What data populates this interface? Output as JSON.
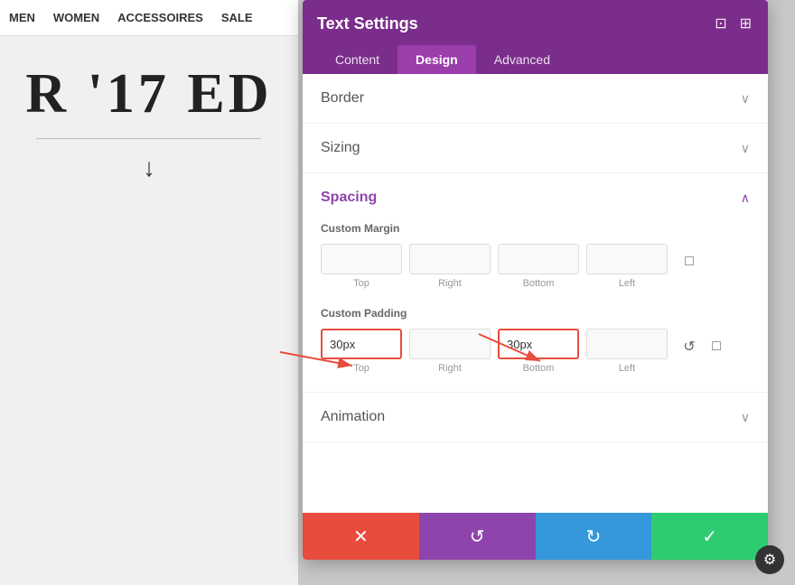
{
  "website": {
    "nav_items": [
      "MEN",
      "WOMEN",
      "ACCESSOIRES",
      "SALE"
    ],
    "hero_text": "R '17 ED",
    "arrow": "↓"
  },
  "panel": {
    "title": "Text Settings",
    "tabs": [
      {
        "label": "Content",
        "active": false
      },
      {
        "label": "Design",
        "active": true
      },
      {
        "label": "Advanced",
        "active": false
      }
    ],
    "sections": [
      {
        "label": "Border",
        "collapsed": true
      },
      {
        "label": "Sizing",
        "collapsed": true
      },
      {
        "label": "Spacing",
        "collapsed": false
      },
      {
        "label": "Animation",
        "collapsed": true
      }
    ],
    "spacing": {
      "custom_margin_label": "Custom Margin",
      "custom_padding_label": "Custom Padding",
      "margin_fields": [
        {
          "value": "",
          "label": "Top"
        },
        {
          "value": "",
          "label": "Right"
        },
        {
          "value": "",
          "label": "Bottom"
        },
        {
          "value": "",
          "label": "Left"
        }
      ],
      "padding_fields": [
        {
          "value": "30px",
          "label": "Top",
          "highlighted": true
        },
        {
          "value": "",
          "label": "Right"
        },
        {
          "value": "30px",
          "label": "Bottom",
          "highlighted": true
        },
        {
          "value": "",
          "label": "Left"
        }
      ]
    },
    "footer_buttons": [
      {
        "symbol": "✕",
        "color": "red",
        "label": "cancel"
      },
      {
        "symbol": "↺",
        "color": "purple",
        "label": "undo"
      },
      {
        "symbol": "↻",
        "color": "blue",
        "label": "redo"
      },
      {
        "symbol": "✓",
        "color": "green",
        "label": "save"
      }
    ]
  },
  "icons": {
    "minimize": "⊡",
    "expand": "⊞",
    "chevron_down": "∨",
    "chevron_up": "∧",
    "mobile": "□",
    "reset": "↺",
    "settings": "⚙"
  }
}
